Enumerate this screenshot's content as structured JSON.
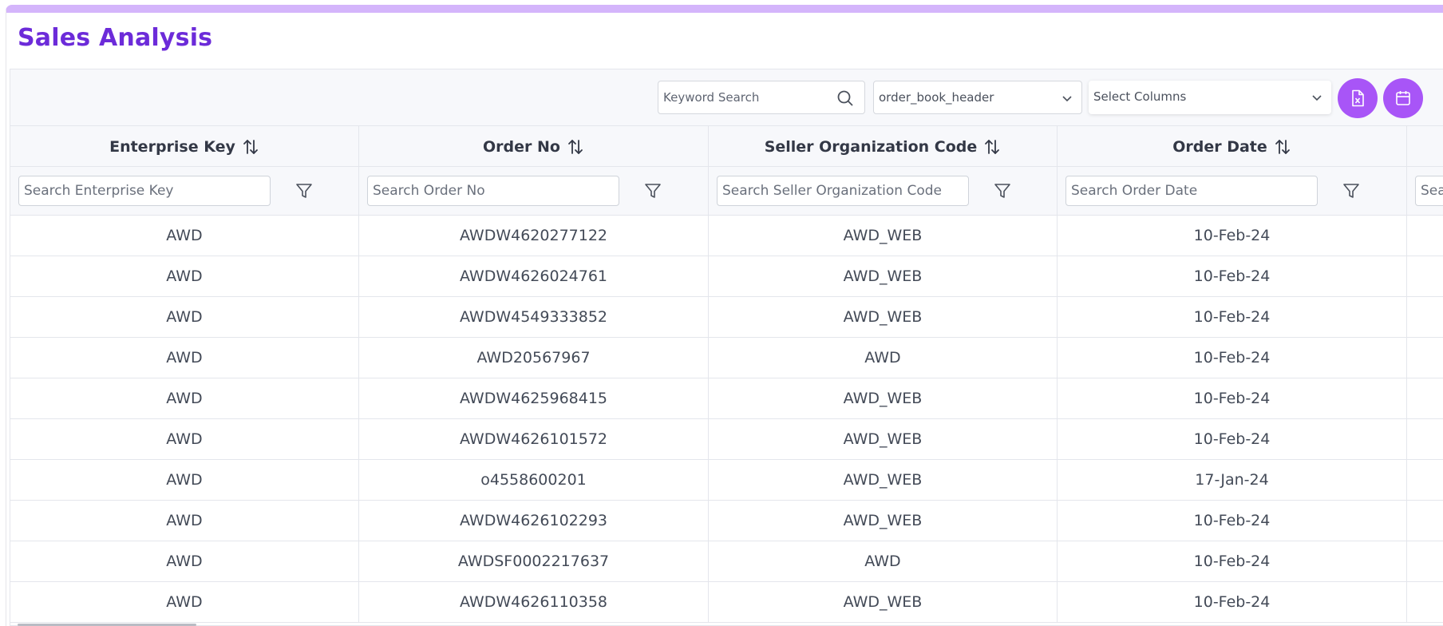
{
  "page": {
    "title": "Sales Analysis"
  },
  "toolbar": {
    "keyword_placeholder": "Keyword Search",
    "table_select_value": "order_book_header",
    "columns_select_value": "Select Columns",
    "excel_icon": "excel-export-icon",
    "calendar_icon": "calendar-icon"
  },
  "columns": [
    {
      "label": "Enterprise Key",
      "filter_placeholder": "Search Enterprise Key"
    },
    {
      "label": "Order No",
      "filter_placeholder": "Search Order No"
    },
    {
      "label": "Seller Organization Code",
      "filter_placeholder": "Search Seller Organization Code"
    },
    {
      "label": "Order Date",
      "filter_placeholder": "Search Order Date"
    },
    {
      "label": "",
      "filter_placeholder": "Search"
    }
  ],
  "rows": [
    [
      "AWD",
      "AWDW4620277122",
      "AWD_WEB",
      "10-Feb-24"
    ],
    [
      "AWD",
      "AWDW4626024761",
      "AWD_WEB",
      "10-Feb-24"
    ],
    [
      "AWD",
      "AWDW4549333852",
      "AWD_WEB",
      "10-Feb-24"
    ],
    [
      "AWD",
      "AWD20567967",
      "AWD",
      "10-Feb-24"
    ],
    [
      "AWD",
      "AWDW4625968415",
      "AWD_WEB",
      "10-Feb-24"
    ],
    [
      "AWD",
      "AWDW4626101572",
      "AWD_WEB",
      "10-Feb-24"
    ],
    [
      "AWD",
      "o4558600201",
      "AWD_WEB",
      "17-Jan-24"
    ],
    [
      "AWD",
      "AWDW4626102293",
      "AWD_WEB",
      "10-Feb-24"
    ],
    [
      "AWD",
      "AWDSF0002217637",
      "AWD",
      "10-Feb-24"
    ],
    [
      "AWD",
      "AWDW4626110358",
      "AWD_WEB",
      "10-Feb-24"
    ]
  ],
  "colors": {
    "accent": "#a855f7",
    "title": "#6c2bd9",
    "top_bar": "#d4b5fb"
  }
}
